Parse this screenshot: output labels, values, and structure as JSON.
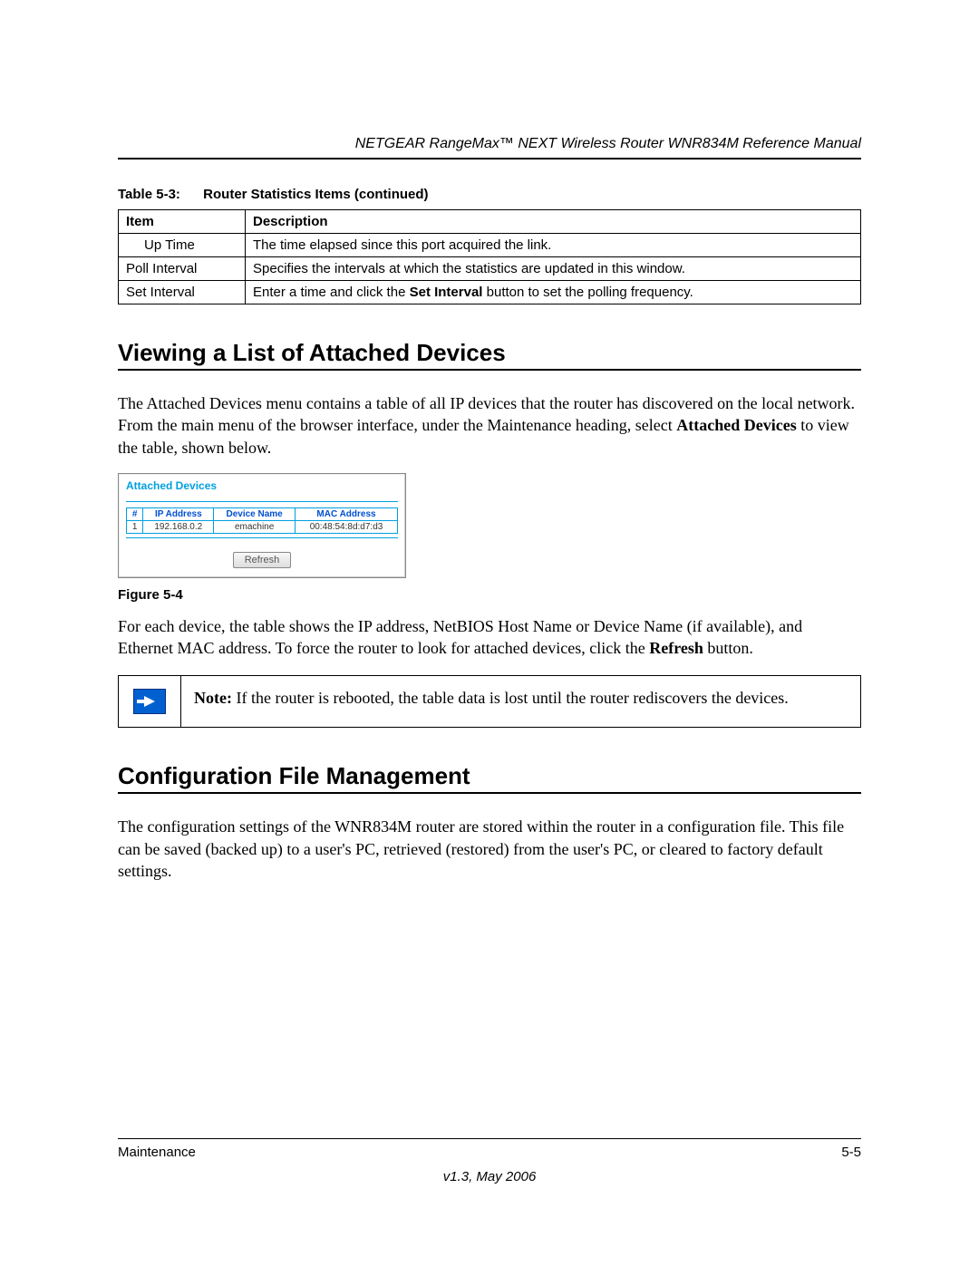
{
  "header": {
    "doc_title": "NETGEAR RangeMax™ NEXT Wireless Router WNR834M Reference Manual"
  },
  "table53": {
    "caption_num": "Table 5-3:",
    "caption_text": "Router Statistics Items (continued)",
    "headers": {
      "c1": "Item",
      "c2": "Description"
    },
    "rows": [
      {
        "item": "Up Time",
        "indent": true,
        "desc": "The time elapsed since this port acquired the link."
      },
      {
        "item": "Poll Interval",
        "indent": false,
        "desc": "Specifies the intervals at which the statistics are updated in this window."
      },
      {
        "item": "Set Interval",
        "indent": false,
        "desc_pre": "Enter a time and click the ",
        "desc_bold": "Set Interval",
        "desc_post": " button to set the polling frequency."
      }
    ]
  },
  "section1": {
    "heading": "Viewing a List of Attached Devices",
    "para1_pre": "The Attached Devices menu contains a table of all IP devices that the router has discovered on the local network. From the main menu of the browser interface, under the Maintenance heading, select ",
    "para1_bold": "Attached Devices",
    "para1_post": " to view the table, shown below."
  },
  "figure": {
    "panel_title": "Attached Devices",
    "cols": {
      "num": "#",
      "ip": "IP Address",
      "name": "Device Name",
      "mac": "MAC Address"
    },
    "row": {
      "num": "1",
      "ip": "192.168.0.2",
      "name": "emachine",
      "mac": "00:48:54:8d:d7:d3"
    },
    "refresh": "Refresh",
    "label": "Figure 5-4"
  },
  "section1b": {
    "para2_pre": "For each device, the table shows the IP address, NetBIOS Host Name or Device Name (if available), and Ethernet MAC address. To force the router to look for attached devices, click the ",
    "para2_bold": "Refresh",
    "para2_post": " button."
  },
  "note": {
    "lead": "Note: ",
    "text": "If the router is rebooted, the table data is lost until the router rediscovers the devices."
  },
  "section2": {
    "heading": "Configuration File Management",
    "para": "The configuration settings of the WNR834M router are stored within the router in a configuration file. This file can be saved (backed up) to a user's PC, retrieved (restored) from the user's PC, or cleared to factory default settings."
  },
  "footer": {
    "left": "Maintenance",
    "right": "5-5",
    "version": "v1.3, May 2006"
  }
}
